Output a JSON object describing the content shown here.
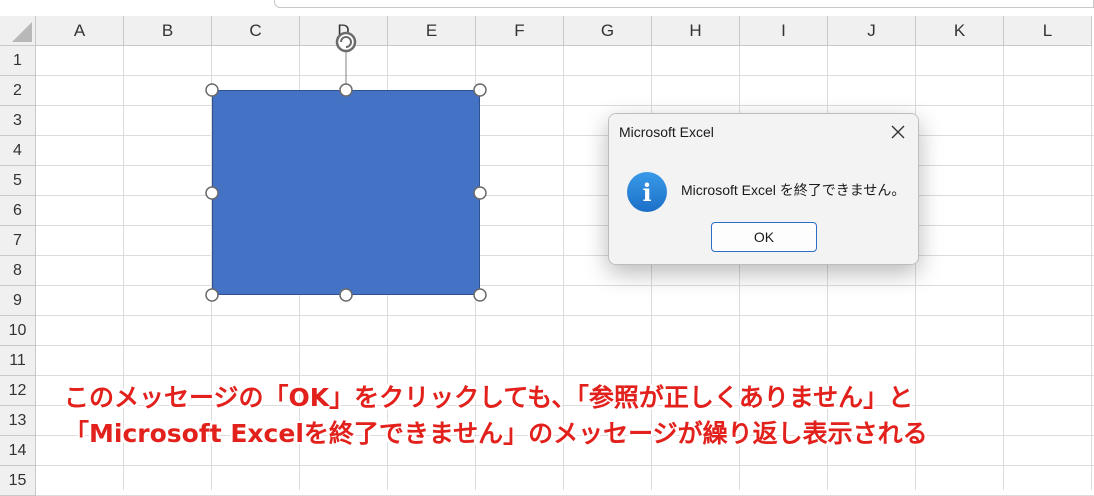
{
  "spreadsheet": {
    "columns": [
      "A",
      "B",
      "C",
      "D",
      "E",
      "F",
      "G",
      "H",
      "I",
      "J",
      "K",
      "L"
    ],
    "rows": [
      "1",
      "2",
      "3",
      "4",
      "5",
      "6",
      "7",
      "8",
      "9",
      "10",
      "11",
      "12",
      "13",
      "14",
      "15"
    ]
  },
  "dialog": {
    "title": "Microsoft Excel",
    "icon": "info-icon",
    "message": "Microsoft Excel を終了できません。",
    "ok_label": "OK",
    "close_glyph": "✕"
  },
  "shape": {
    "fill": "#4472c4",
    "icon": "rotate-handle-icon"
  },
  "annotation": {
    "line1": "このメッセージの「OK」をクリックしても、「参照が正しくありません」と",
    "line2": "「Microsoft Excelを終了できません」のメッセージが繰り返し表示される",
    "color": "#e2211c"
  }
}
